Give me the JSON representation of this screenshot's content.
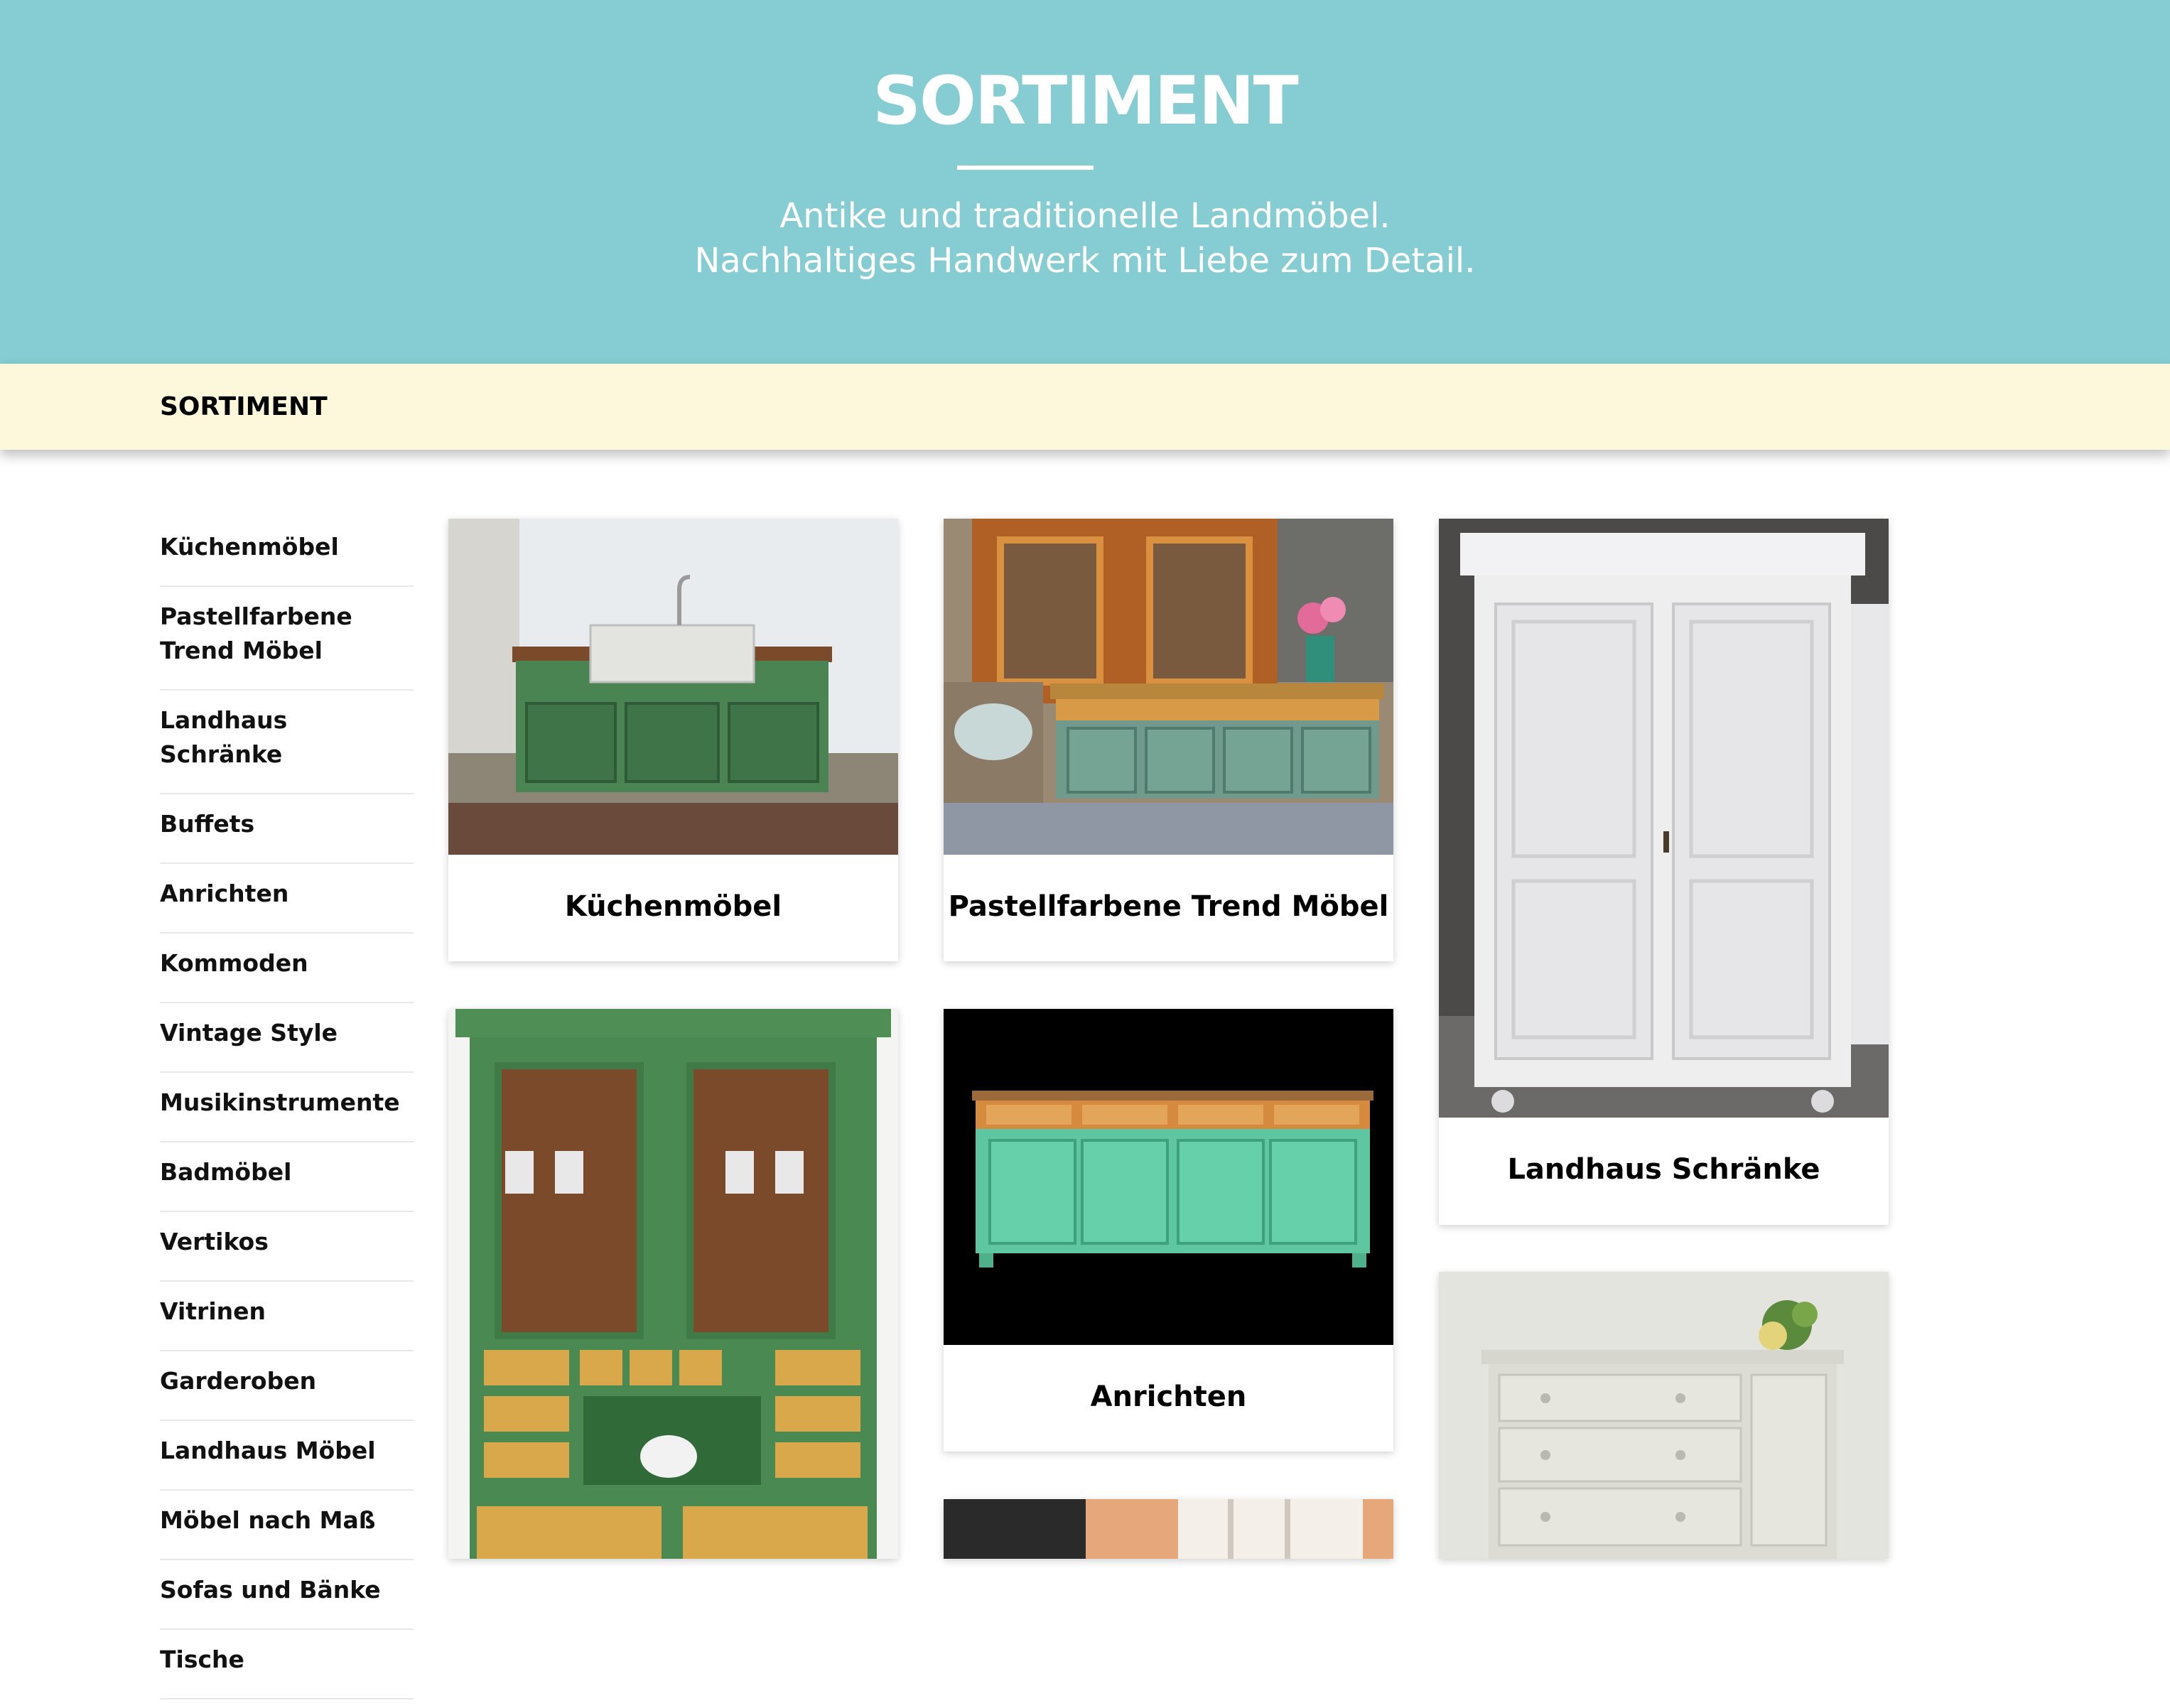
{
  "hero": {
    "title": "SORTIMENT",
    "subtitle_line1": "Antike und traditionelle Landmöbel.",
    "subtitle_line2": "Nachhaltiges Handwerk mit Liebe zum Detail."
  },
  "breadcrumb": {
    "label": "SORTIMENT"
  },
  "sidebar": {
    "items": [
      {
        "label": "Küchenmöbel"
      },
      {
        "label": "Pastellfarbene Trend Möbel"
      },
      {
        "label": "Landhaus Schränke"
      },
      {
        "label": "Buffets"
      },
      {
        "label": "Anrichten"
      },
      {
        "label": "Kommoden"
      },
      {
        "label": "Vintage Style"
      },
      {
        "label": "Musikinstrumente"
      },
      {
        "label": "Badmöbel"
      },
      {
        "label": "Vertikos"
      },
      {
        "label": "Vitrinen"
      },
      {
        "label": "Garderoben"
      },
      {
        "label": "Landhaus Möbel"
      },
      {
        "label": "Möbel nach Maß"
      },
      {
        "label": "Sofas und Bänke"
      },
      {
        "label": "Tische"
      }
    ]
  },
  "cards": [
    {
      "label": "Küchenmöbel"
    },
    {
      "label": "Pastellfarbene Trend Möbel"
    },
    {
      "label": "Landhaus Schränke"
    },
    {
      "label": "Anrichten"
    }
  ],
  "colors": {
    "hero_bg": "#85cdd2",
    "breadcrumb_bg": "#fdf8dc"
  }
}
